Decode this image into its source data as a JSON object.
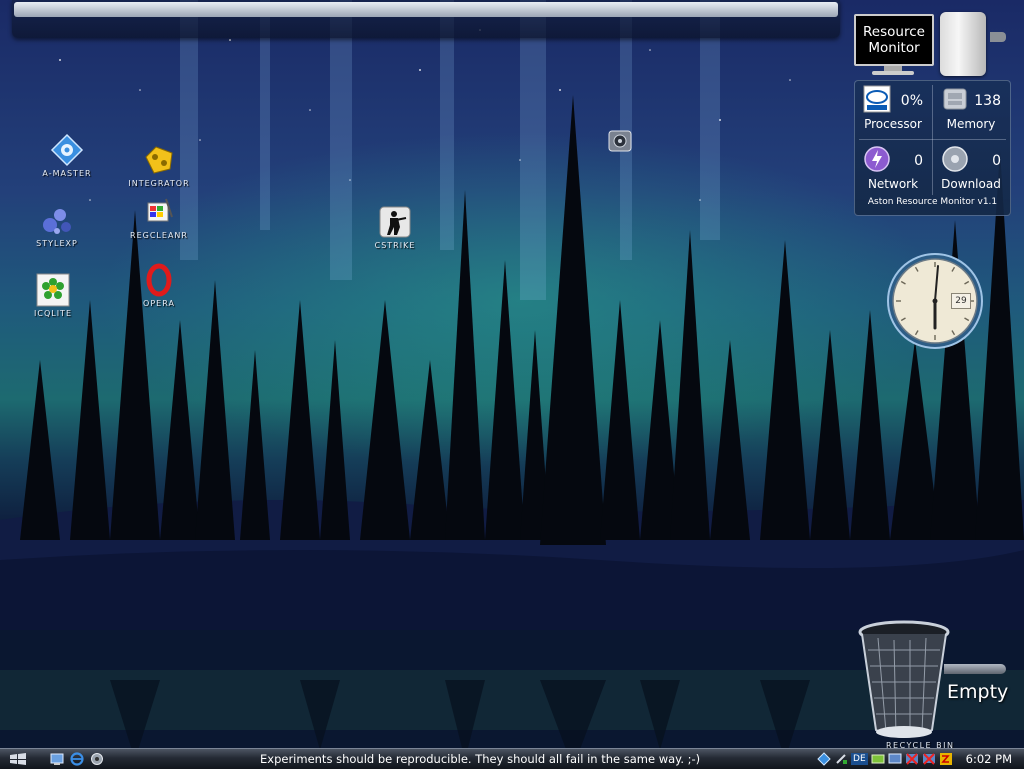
{
  "topbar": {
    "items": [
      "",
      "",
      "",
      "",
      ""
    ]
  },
  "desktop_icons": [
    {
      "id": "a-master",
      "label": "A-MASTER",
      "icon": "snowflake-gear-icon"
    },
    {
      "id": "integrator",
      "label": "INTEGRATOR",
      "icon": "yellow-puzzle-icon"
    },
    {
      "id": "stylexp",
      "label": "STYLEXP",
      "icon": "blue-bubbles-icon"
    },
    {
      "id": "regcleanr",
      "label": "REGCLEANR",
      "icon": "registry-cleaner-icon"
    },
    {
      "id": "icqlite",
      "label": "ICQLITE",
      "icon": "icq-flower-icon"
    },
    {
      "id": "opera",
      "label": "OPERA",
      "icon": "opera-o-icon"
    },
    {
      "id": "cstrike",
      "label": "CSTRIKE",
      "icon": "counter-strike-icon"
    },
    {
      "id": "monitor-widget",
      "label": "",
      "icon": "monitor-speaker-icon"
    }
  ],
  "resource_monitor": {
    "title_line1": "Resource",
    "title_line2": "Monitor",
    "processor": {
      "label": "Processor",
      "value": "0%"
    },
    "memory": {
      "label": "Memory",
      "value": "138"
    },
    "network": {
      "label": "Network",
      "value": "0"
    },
    "download": {
      "label": "Download",
      "value": "0"
    },
    "footer": "Aston Resource Monitor v1.1"
  },
  "clock": {
    "date": "29",
    "time_display": "6:02"
  },
  "recycle_bin": {
    "status": "Empty",
    "label": "RECYCLE BIN"
  },
  "taskbar": {
    "message": "Experiments should be reproducible. They should all fail in the same way. ;-)",
    "language": "DE",
    "time": "6:02 PM"
  },
  "colors": {
    "sky_top": "#1a2a66",
    "aurora": "#1d6a70",
    "snow": "#0d1838",
    "taskbar": "#242a34"
  }
}
